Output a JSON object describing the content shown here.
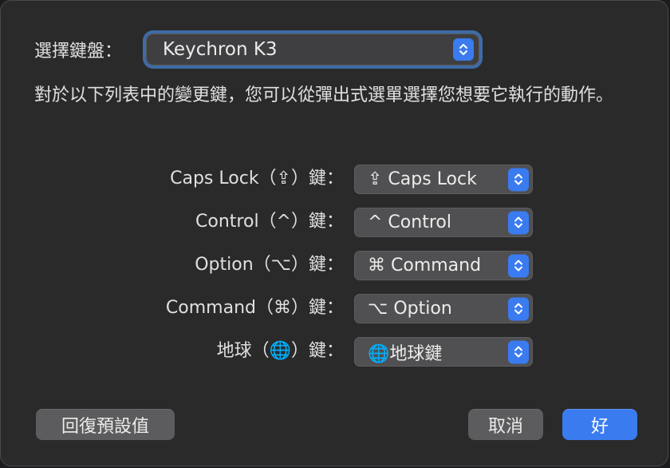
{
  "keyboard": {
    "label": "選擇鍵盤：",
    "selected": "Keychron K3"
  },
  "description": "對於以下列表中的變更鍵，您可以從彈出式選單選擇您想要它執行的動作。",
  "modifiers": [
    {
      "label": "Caps Lock（⇪）鍵：",
      "value": "⇪ Caps Lock"
    },
    {
      "label": "Control（^）鍵：",
      "value": "^ Control"
    },
    {
      "label": "Option（⌥）鍵：",
      "value": "⌘ Command"
    },
    {
      "label": "Command（⌘）鍵：",
      "value": "⌥ Option"
    },
    {
      "label": "地球（🌐）鍵：",
      "value": "🌐地球鍵"
    }
  ],
  "buttons": {
    "restore_defaults": "回復預設值",
    "cancel": "取消",
    "ok": "好"
  },
  "colors": {
    "accent": "#3a7bf0",
    "focus_ring": "#3e6ba5",
    "sheet_bg": "#2a2a2a"
  }
}
